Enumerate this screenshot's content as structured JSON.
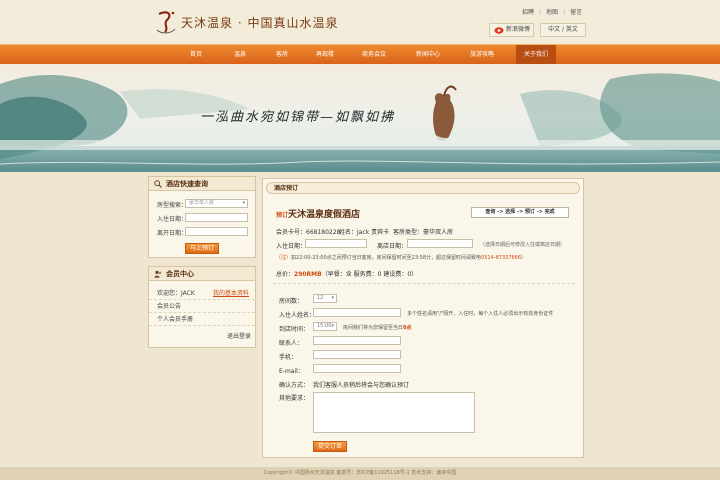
{
  "brand": {
    "tagline": "天沐温泉 · 中国真山水温泉"
  },
  "toplinks": [
    "招聘",
    "地图",
    "留言"
  ],
  "weibo_label": "新浪微博",
  "lang_label": "中文 / 英文",
  "nav": [
    "首页",
    "温泉",
    "客房",
    "再现楼",
    "商务会议",
    "新闻中心",
    "旅游攻略",
    "关于我们"
  ],
  "nav_active": "关于我们",
  "banner_text": "一泓曲水宛如锦带—如飘如拂",
  "quick": {
    "title": "酒店快速查询",
    "room_type_label": "房型搜索：",
    "room_type_value": "豪华单人房",
    "checkin_label": "入住日期：",
    "checkout_label": "离开日期：",
    "book_button": "马上预订"
  },
  "member": {
    "title": "会员中心",
    "welcome": "欢迎您：JACK",
    "edit_link": "我的基本资料",
    "notice": "会员公告",
    "manual": "个人会员手册",
    "logout": "退出登录"
  },
  "main": {
    "breadcrumb": "酒店预订",
    "tag": "预订",
    "hotel_name": "天沐温泉度假酒店",
    "steps": "查询 -> 选择 -> 预订 -> 完成",
    "member_no": "会员卡号：668180228",
    "name": "姓名：Jack 贵宾卡",
    "room_type": "客房类型：豪华双人房",
    "checkin_label": "入住日期：",
    "checkout_label": "离店日期：",
    "date_hint": "（选择日期后可修改入住或离店日期）",
    "notice_prefix": "（注）",
    "notice_text": "如22:00-23:00点之间预订当日客房，房间保留时间至23:58分，超过保留时间请致电",
    "notice_phone": "0514-87337666",
    "notice_end": "）",
    "total_label": "总价：",
    "total_value": "290RMB",
    "total_detail": "（早餐：含  服务费：0  建设费：0）",
    "rooms_label": "房间数：",
    "rooms_value": "12",
    "guest_label": "入住人姓名：",
    "guest_hint": "多个姓名请用\"/\"隔开，入住时，每个入住人必须出示有效身份证件",
    "arrive_label": "到店时间：",
    "arrive_value": "15:00",
    "arrive_hint": "房间我们将为您保留至当日",
    "arrive_hint_time": "8点",
    "contact_label": "联系人：",
    "mobile_label": "手机：",
    "email_label": "E-mail：",
    "confirm_label": "确认方式：",
    "confirm_value": "我们客服人员稍后将会与您确认预订",
    "other_label": "其他要求：",
    "submit": "提交订单"
  },
  "footer": "Copyright© 中国扬州天沐温泉   备案号：苏ICP备11025118号-1   技术支持：谦卓中国",
  "colors": {
    "accent": "#e2721f",
    "brand_brown": "#5a2e10",
    "link_red": "#d04a10",
    "page_bg": "#efe6d2"
  }
}
